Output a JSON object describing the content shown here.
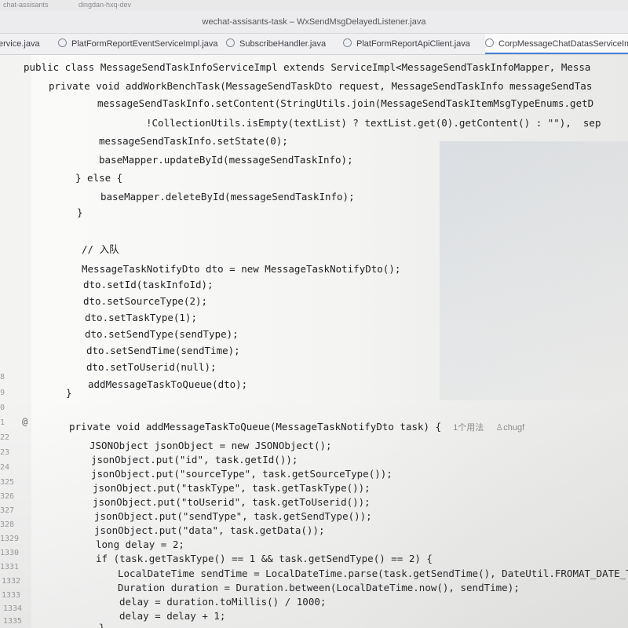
{
  "topbar": {
    "left_text": "chat-assisants",
    "right_text": "dingdan-hxq-dev"
  },
  "window": {
    "title": "wechat-assisants-task – WxSendMsgDelayedListener.java"
  },
  "tabs": [
    {
      "label": "ervice.java",
      "icon": "java-class-icon"
    },
    {
      "label": "PlatFormReportEventServiceImpl.java",
      "icon": "java-class-icon"
    },
    {
      "label": "SubscribeHandler.java",
      "icon": "java-class-icon"
    },
    {
      "label": "PlatFormReportApiClient.java",
      "icon": "java-class-icon"
    },
    {
      "label": "CorpMessageChatDatasServiceIm",
      "icon": "java-class-icon"
    }
  ],
  "editor": {
    "sticky": [
      "public class MessageSendTaskInfoServiceImpl extends ServiceImpl<MessageSendTaskInfoMapper, Messa",
      "private void addWorkBenchTask(MessageSendTaskDto request, MessageSendTaskInfo messageSendTas"
    ],
    "lines": [
      "messageSendTaskInfo.setContent(StringUtils.join(MessageSendTaskItemMsgTypeEnums.getD",
      "!CollectionUtils.isEmpty(textList) ? textList.get(0).getContent() : \"\"),  sep",
      "messageSendTaskInfo.setState(0);",
      "baseMapper.updateById(messageSendTaskInfo);",
      "} else {",
      "baseMapper.deleteById(messageSendTaskInfo);",
      "}",
      "// 入队",
      "MessageTaskNotifyDto dto = new MessageTaskNotifyDto();",
      "dto.setId(taskInfoId);",
      "dto.setSourceType(2);",
      "dto.setTaskType(1);",
      "dto.setSendType(sendType);",
      "dto.setSendTime(sendTime);",
      "dto.setToUserid(null);",
      "addMessageTaskToQueue(dto);",
      "}",
      "private void addMessageTaskToQueue(MessageTaskNotifyDto task) {",
      "JSONObject jsonObject = new JSONObject();",
      "jsonObject.put(\"id\", task.getId());",
      "jsonObject.put(\"sourceType\", task.getSourceType());",
      "jsonObject.put(\"taskType\", task.getTaskType());",
      "jsonObject.put(\"toUserid\", task.getToUserid());",
      "jsonObject.put(\"sendType\", task.getSendType());",
      "jsonObject.put(\"data\", task.getData());",
      "long delay = 2;",
      "if (task.getTaskType() == 1 && task.getSendType() == 2) {",
      "LocalDateTime sendTime = LocalDateTime.parse(task.getSendTime(), DateUtil.FROMAT_DATE_TIME);",
      "Duration duration = Duration.between(LocalDateTime.now(), sendTime);",
      "delay = duration.toMillis() / 1000;",
      "delay = delay + 1;",
      "}"
    ],
    "usage_hint": "1个用法",
    "author_hint": "chugf",
    "line_numbers": [
      "8",
      "9",
      "0",
      "1",
      "22",
      "23",
      "24",
      "325",
      "326",
      "327",
      "328",
      "1329",
      "1330",
      "1331",
      "1332",
      "1333",
      "1334",
      "1335"
    ],
    "gutter_mark": "@"
  }
}
